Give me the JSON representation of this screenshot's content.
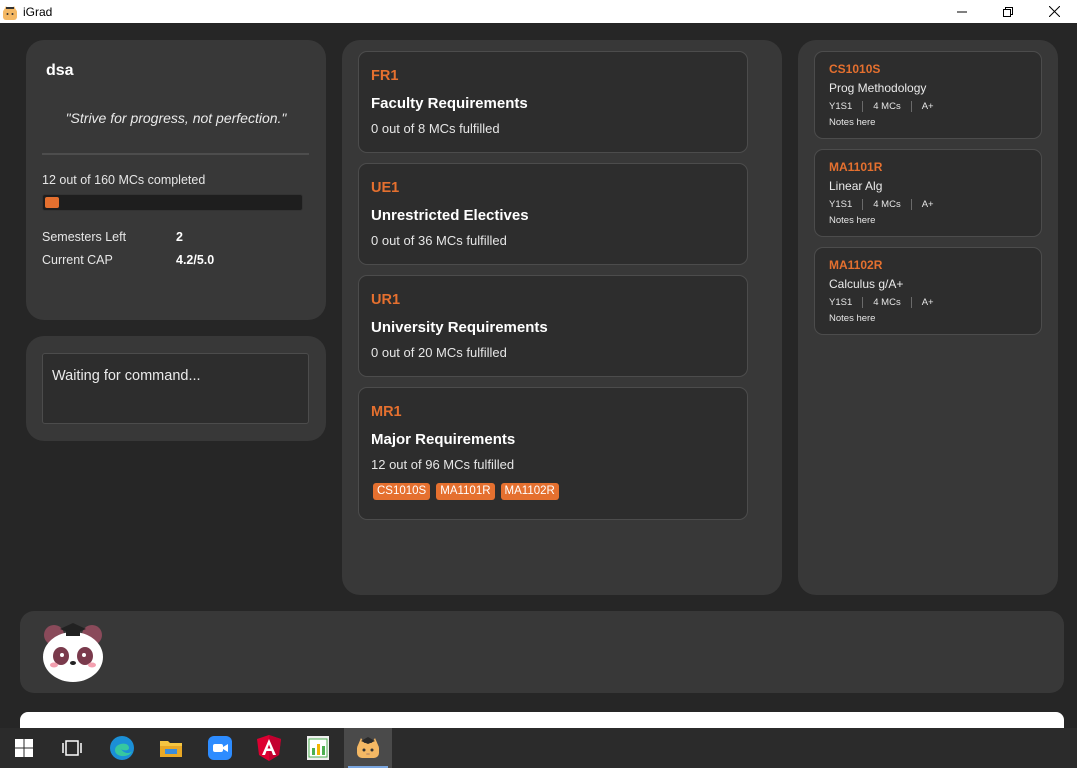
{
  "window": {
    "title": "iGrad"
  },
  "profile": {
    "name": "dsa",
    "quote": "\"Strive for progress, not perfection.\"",
    "mc_summary": "12 out of 160 MCs completed",
    "progress_fraction": 0.075,
    "semesters_left_label": "Semesters Left",
    "semesters_left_value": "2",
    "cap_label": "Current CAP",
    "cap_value": "4.2/5.0"
  },
  "command_result": {
    "text": "Waiting for command..."
  },
  "requirements": [
    {
      "code": "FR1",
      "title": "Faculty Requirements",
      "progress": "0 out of 8 MCs fulfilled",
      "modules": []
    },
    {
      "code": "UE1",
      "title": "Unrestricted Electives",
      "progress": "0 out of 36 MCs fulfilled",
      "modules": []
    },
    {
      "code": "UR1",
      "title": "University Requirements",
      "progress": "0 out of 20 MCs fulfilled",
      "modules": []
    },
    {
      "code": "MR1",
      "title": "Major Requirements",
      "progress": "12 out of 96 MCs fulfilled",
      "modules": [
        "CS1010S",
        "MA1101R",
        "MA1102R"
      ]
    }
  ],
  "modules": [
    {
      "code": "CS1010S",
      "name": "Prog Methodology",
      "semester": "Y1S1",
      "mcs": "4 MCs",
      "grade": "A+",
      "notes": "Notes here"
    },
    {
      "code": "MA1101R",
      "name": "Linear Alg",
      "semester": "Y1S1",
      "mcs": "4 MCs",
      "grade": "A+",
      "notes": "Notes here"
    },
    {
      "code": "MA1102R",
      "name": "Calculus g/A+",
      "semester": "Y1S1",
      "mcs": "4 MCs",
      "grade": "A+",
      "notes": "Notes here"
    }
  ],
  "colors": {
    "accent": "#e5702f",
    "background": "#262626",
    "panel": "#383838",
    "card": "#2d2d2d"
  },
  "taskbar": {
    "items": [
      "windows-start-icon",
      "task-view-icon",
      "edge-browser-icon",
      "file-explorer-icon",
      "zoom-icon",
      "angular-icon",
      "spreadsheet-icon",
      "igrad-app-icon"
    ]
  }
}
